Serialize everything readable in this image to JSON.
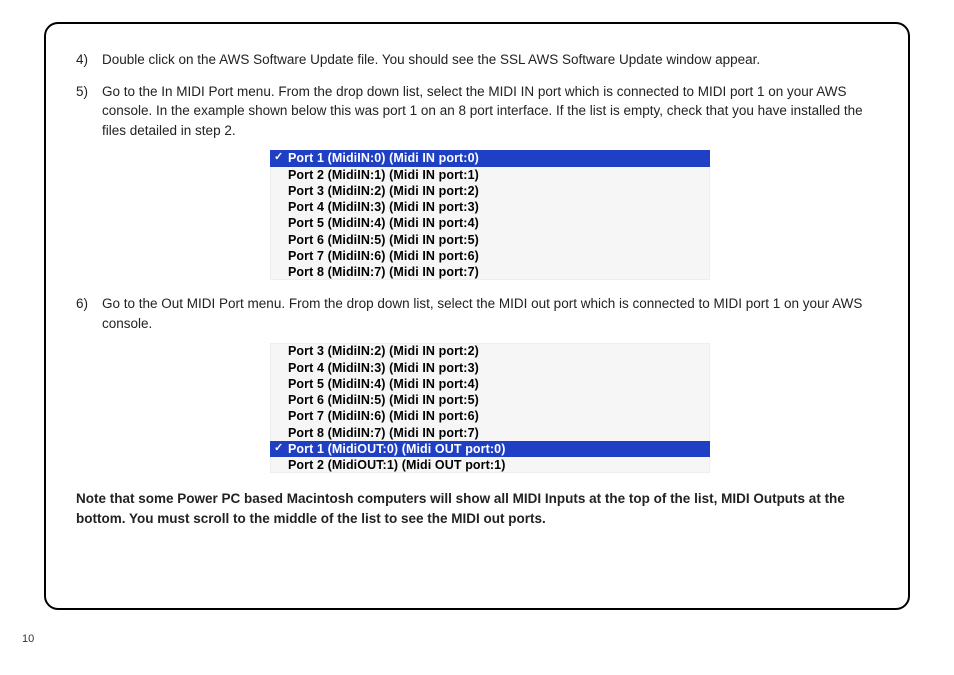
{
  "page_number": "10",
  "steps": [
    {
      "text": "Double click on the AWS Software Update file. You should see the SSL AWS Software Update window appear."
    },
    {
      "text": "Go to the In MIDI Port menu. From the drop down list, select the MIDI IN port which is connected to MIDI port 1 on your AWS console. In the example shown below this was port 1 on an 8 port interface. If the list is empty, check that you have installed the files detailed in step 2.",
      "dropdown": [
        {
          "label": "Port 1 (MidiIN:0) (Midi IN port:0)",
          "selected": true
        },
        {
          "label": "Port 2 (MidiIN:1) (Midi IN port:1)",
          "selected": false
        },
        {
          "label": "Port 3 (MidiIN:2) (Midi IN port:2)",
          "selected": false
        },
        {
          "label": "Port 4 (MidiIN:3) (Midi IN port:3)",
          "selected": false
        },
        {
          "label": "Port 5 (MidiIN:4) (Midi IN port:4)",
          "selected": false
        },
        {
          "label": "Port 6 (MidiIN:5) (Midi IN port:5)",
          "selected": false
        },
        {
          "label": "Port 7 (MidiIN:6) (Midi IN port:6)",
          "selected": false
        },
        {
          "label": "Port 8 (MidiIN:7) (Midi IN port:7)",
          "selected": false
        }
      ]
    },
    {
      "text": "Go to the Out MIDI Port menu. From the drop down list, select the MIDI out port which is connected to MIDI port 1 on your AWS console.",
      "dropdown": [
        {
          "label": "Port 3 (MidiIN:2) (Midi IN port:2)",
          "selected": false
        },
        {
          "label": "Port 4 (MidiIN:3) (Midi IN port:3)",
          "selected": false
        },
        {
          "label": "Port 5 (MidiIN:4) (Midi IN port:4)",
          "selected": false
        },
        {
          "label": "Port 6 (MidiIN:5) (Midi IN port:5)",
          "selected": false
        },
        {
          "label": "Port 7 (MidiIN:6) (Midi IN port:6)",
          "selected": false
        },
        {
          "label": "Port 8 (MidiIN:7) (Midi IN port:7)",
          "selected": false
        },
        {
          "label": "Port 1 (MidiOUT:0) (Midi OUT port:0)",
          "selected": true
        },
        {
          "label": "Port 2 (MidiOUT:1) (Midi OUT port:1)",
          "selected": false
        }
      ]
    }
  ],
  "note": "Note that some Power PC based Macintosh computers will show all MIDI Inputs at the top of the list, MIDI Outputs at the bottom. You must scroll to the middle of the list to see the MIDI out ports."
}
